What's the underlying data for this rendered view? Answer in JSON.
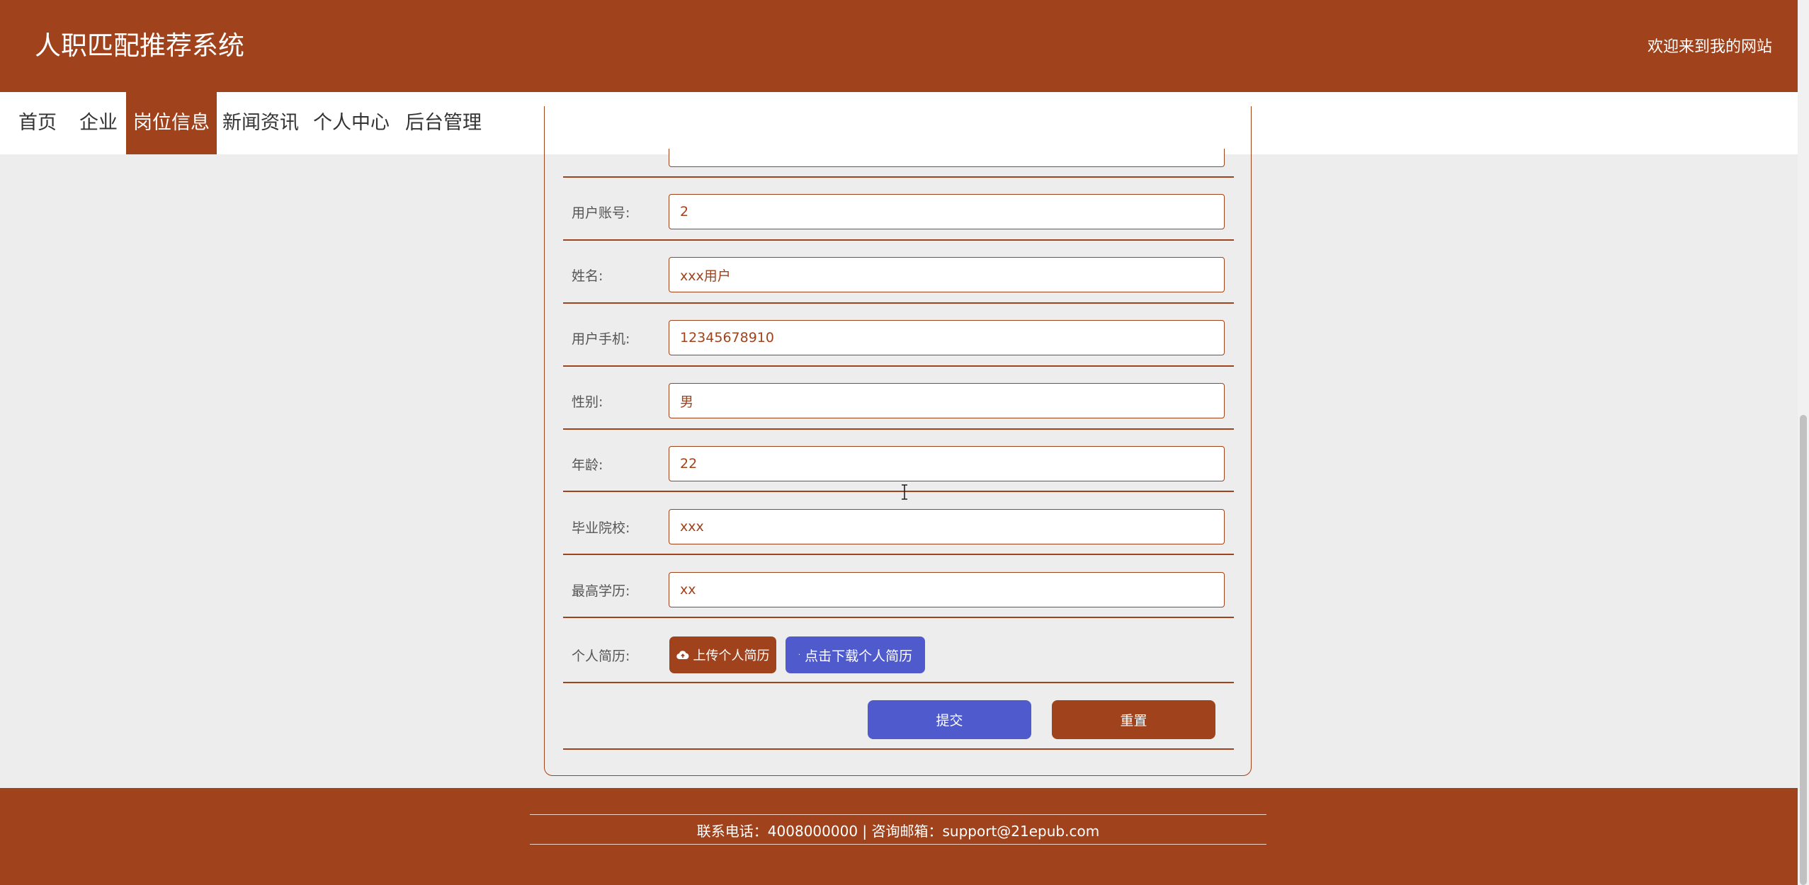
{
  "header": {
    "title": "人职匹配推荐系统",
    "welcome": "欢迎来到我的网站"
  },
  "nav": {
    "items": [
      "首页",
      "企业",
      "岗位信息",
      "新闻资讯",
      "个人中心",
      "后台管理"
    ],
    "active": "岗位信息"
  },
  "form": {
    "fields": [
      {
        "label": "用户账号:",
        "value": "2"
      },
      {
        "label": "姓名:",
        "value": "xxx用户"
      },
      {
        "label": "用户手机:",
        "value": "12345678910"
      },
      {
        "label": "性别:",
        "value": "男"
      },
      {
        "label": "年龄:",
        "value": "22"
      },
      {
        "label": "毕业院校:",
        "value": "xxx"
      },
      {
        "label": "最高学历:",
        "value": "xx"
      }
    ],
    "resume": {
      "label": "个人简历:",
      "upload": "上传个人简历",
      "download": "点击下载个人简历"
    },
    "submit": "提交",
    "reset": "重置"
  },
  "footer": {
    "contact": "联系电话：4008000000 | 咨询邮箱：support@21epub.com"
  },
  "colors": {
    "brand": "#a0421b",
    "accent": "#4f5bcc",
    "background": "#ededed"
  }
}
